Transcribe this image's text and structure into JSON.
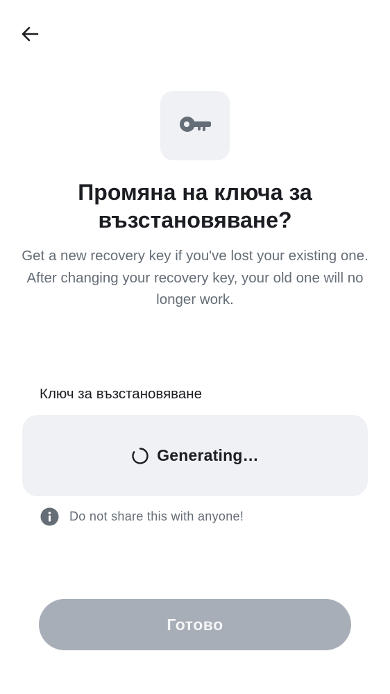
{
  "header": {
    "back_icon": "arrow-left-icon"
  },
  "hero": {
    "icon": "key-icon",
    "title": "Промяна на ключа за възстановяване?",
    "description": "Get a new recovery key if you've lost your existing one. After changing your recovery key, your old one will no longer work."
  },
  "recovery_key": {
    "label": "Ключ за възстановяване",
    "status_text": "Generating…",
    "status_icon": "spinner-icon",
    "hint_icon": "info-icon",
    "hint_text": "Do not share this with anyone!"
  },
  "footer": {
    "done_label": "Готово",
    "done_disabled": true
  },
  "colors": {
    "text_primary": "#1b1d22",
    "text_secondary": "#656d77",
    "surface": "#f0f1f5",
    "button_disabled": "#a7aeb7"
  }
}
